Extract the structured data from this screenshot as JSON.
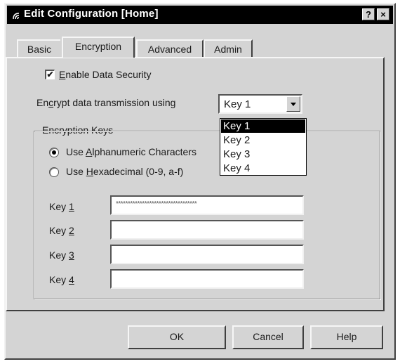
{
  "window": {
    "title": "Edit Configuration [Home]",
    "help_btn": "?",
    "close_btn": "×"
  },
  "tabs": [
    {
      "label": "Basic",
      "active": false
    },
    {
      "label": "Encryption",
      "active": true
    },
    {
      "label": "Advanced",
      "active": false
    },
    {
      "label": "Admin",
      "active": false
    }
  ],
  "security": {
    "enable_label_pre": "",
    "enable_label_accel": "E",
    "enable_label_post": "nable Data Security",
    "enabled": true,
    "check_glyph": "✔"
  },
  "encrypt": {
    "label_pre": "En",
    "label_accel": "c",
    "label_post": "rypt data transmission using",
    "selected": "Key 1",
    "options": [
      "Key 1",
      "Key 2",
      "Key 3",
      "Key 4"
    ]
  },
  "keys_group": {
    "legend": "Encryption Keys",
    "radio_alpha_pre": "Use ",
    "radio_alpha_accel": "A",
    "radio_alpha_post": "lphanumeric Characters",
    "radio_hex_pre": "Use ",
    "radio_hex_accel": "H",
    "radio_hex_post": "exadecimal (0-9, a-f)",
    "selected_mode": "alphanumeric",
    "keys": [
      {
        "label_pre": "Key ",
        "label_accel": "1",
        "value": "**********************************"
      },
      {
        "label_pre": "Key ",
        "label_accel": "2",
        "value": ""
      },
      {
        "label_pre": "Key ",
        "label_accel": "3",
        "value": ""
      },
      {
        "label_pre": "Key ",
        "label_accel": "4",
        "value": ""
      }
    ]
  },
  "buttons": {
    "ok": "OK",
    "cancel": "Cancel",
    "help": "Help"
  }
}
